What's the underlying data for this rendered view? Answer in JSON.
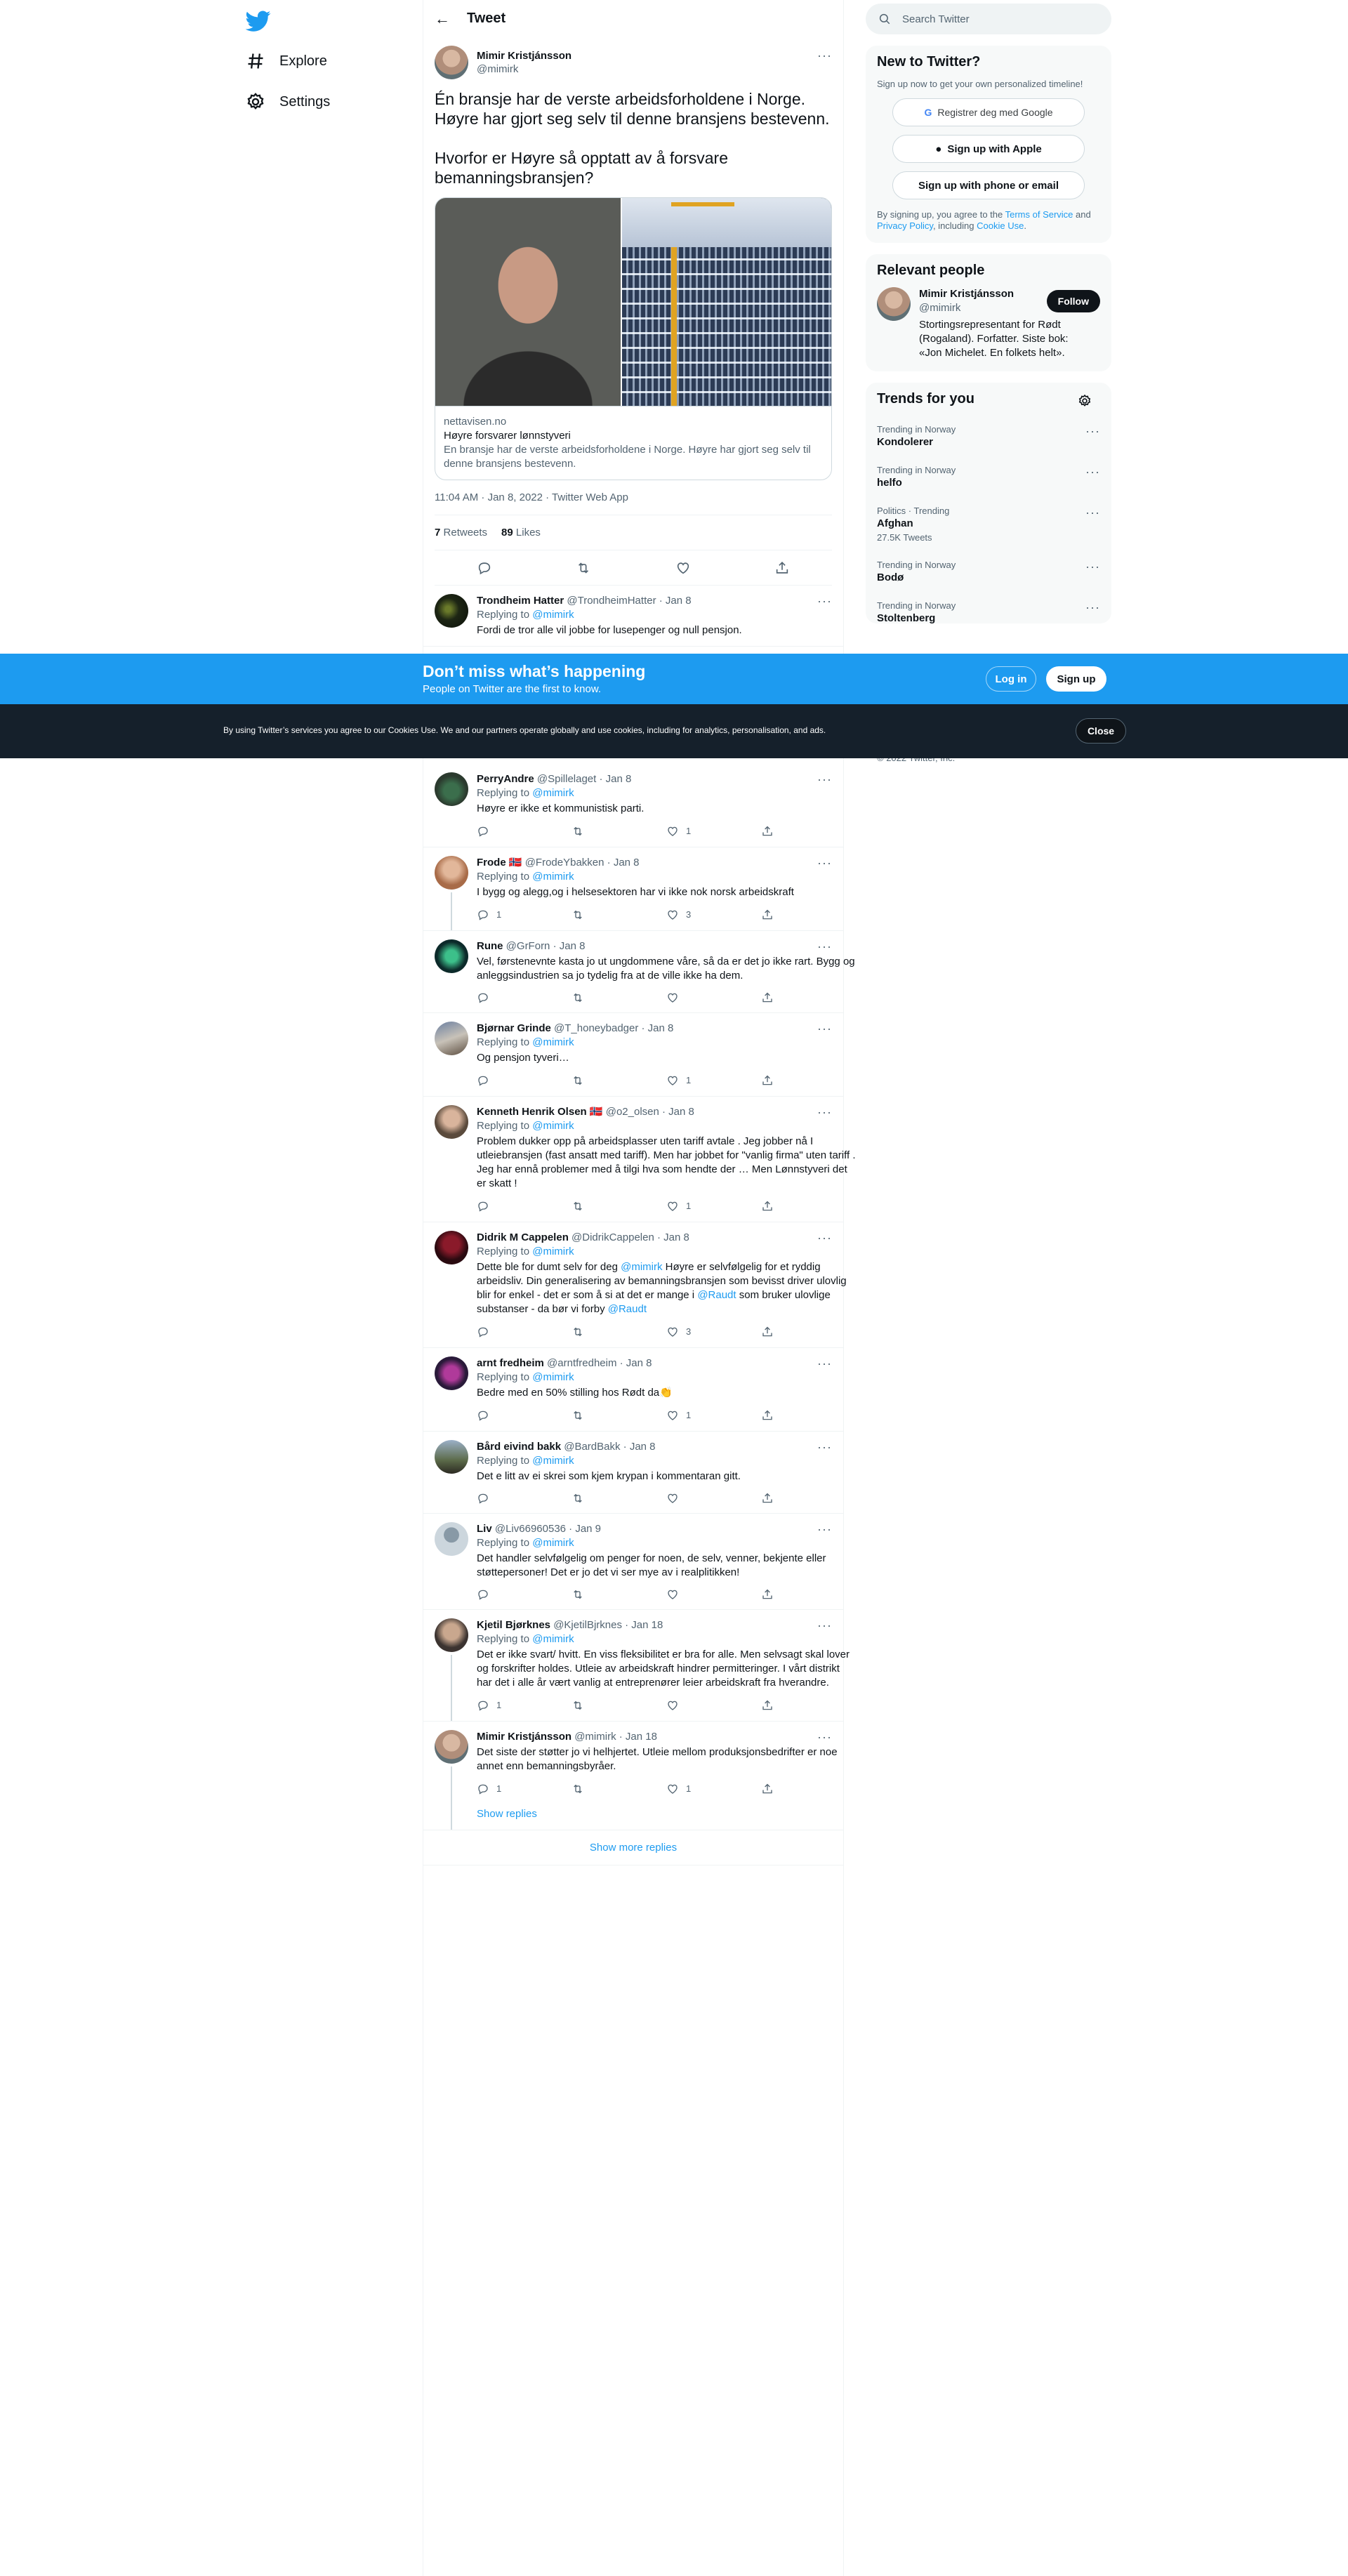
{
  "nav": {
    "explore": "Explore",
    "settings": "Settings"
  },
  "header": {
    "title": "Tweet"
  },
  "main_tweet": {
    "name": "Mimir Kristjánsson",
    "handle": "@mimirk",
    "text": "Én bransje har de verste arbeidsforholdene i Norge. Høyre har gjort seg selv til denne bransjens bestevenn.\n\nHvorfor er Høyre så opptatt av å forsvare bemanningsbransjen?",
    "card": {
      "domain": "nettavisen.no",
      "title": "Høyre forsvarer lønnstyveri",
      "description": "En bransje har de verste arbeidsforholdene i Norge. Høyre har gjort seg selv til denne bransjens bestevenn."
    },
    "meta": "11:04 AM · Jan 8, 2022 · Twitter Web App",
    "retweets_count": "7",
    "retweets_label": "Retweets",
    "likes_count": "89",
    "likes_label": "Likes"
  },
  "replies_top": [
    {
      "name": "Trondheim Hatter",
      "handle": "@TrondheimHatter",
      "date": "· Jan 8",
      "replying_label": "Replying to",
      "replying_to": "@mimirk",
      "text": "Fordi de tror alle vil jobbe for lusepenger og null pensjon."
    }
  ],
  "replies": [
    {
      "name": "PerryAndre",
      "handle": "@Spillelaget",
      "date": "· Jan 8",
      "replying_label": "Replying to",
      "replying_to": "@mimirk",
      "text": "Høyre er ikke et kommunistisk parti.",
      "reply_count": "",
      "rt_count": "",
      "like_count": "1"
    },
    {
      "name": "Frode 🇳🇴",
      "handle": "@FrodeYbakken",
      "date": "· Jan 8",
      "replying_label": "Replying to",
      "replying_to": "@mimirk",
      "text": "I bygg og alegg,og i helsesektoren har vi ikke nok norsk arbeidskraft",
      "reply_count": "1",
      "rt_count": "",
      "like_count": "3"
    },
    {
      "name": "Rune",
      "handle": "@GrForn",
      "date": "· Jan 8",
      "replying_label": "",
      "replying_to": "",
      "text": "Vel, førstenevnte kasta jo ut ungdommene våre, så da er det jo ikke rart. Bygg og anleggsindustrien sa jo tydelig fra at de ville ikke ha dem.",
      "reply_count": "",
      "rt_count": "",
      "like_count": ""
    },
    {
      "name": "Bjørnar Grinde",
      "handle": "@T_honeybadger",
      "date": "· Jan 8",
      "replying_label": "Replying to",
      "replying_to": "@mimirk",
      "text": "Og pensjon tyveri…",
      "reply_count": "",
      "rt_count": "",
      "like_count": "1"
    },
    {
      "name": "Kenneth Henrik Olsen 🇳🇴",
      "handle": "@o2_olsen",
      "date": "· Jan 8",
      "replying_label": "Replying to",
      "replying_to": "@mimirk",
      "text": "Problem dukker opp på arbeidsplasser uten tariff avtale . Jeg jobber nå I utleiebransjen (fast ansatt med tariff). Men har jobbet for \"vanlig firma\" uten tariff . Jeg har ennå problemer med å tilgi hva som hendte der … Men Lønnstyveri det er skatt !",
      "reply_count": "",
      "rt_count": "",
      "like_count": "1"
    },
    {
      "name": "Didrik M Cappelen",
      "handle": "@DidrikCappelen",
      "date": "· Jan 8",
      "replying_label": "Replying to",
      "replying_to": "@mimirk",
      "text_pre": "Dette ble for dumt selv for deg ",
      "text_mention1": "@mimirk",
      "text_mid": " Høyre er selvfølgelig for et ryddig arbeidsliv. Din generalisering av bemanningsbransjen som bevisst driver ulovlig blir for enkel - det er som å si at det er mange i ",
      "text_mention2": "@Raudt",
      "text_mid2": " som bruker ulovlige substanser - da bør vi forby ",
      "text_mention3": "@Raudt",
      "reply_count": "",
      "rt_count": "",
      "like_count": "3"
    },
    {
      "name": "arnt fredheim",
      "handle": "@arntfredheim",
      "date": "· Jan 8",
      "replying_label": "Replying to",
      "replying_to": "@mimirk",
      "text": "Bedre med en 50% stilling hos Rødt da👏",
      "reply_count": "",
      "rt_count": "",
      "like_count": "1"
    },
    {
      "name": "Bård eivind bakk",
      "handle": "@BardBakk",
      "date": "· Jan 8",
      "replying_label": "Replying to",
      "replying_to": "@mimirk",
      "text": "Det e litt av ei skrei som kjem krypan i kommentaran gitt.",
      "reply_count": "",
      "rt_count": "",
      "like_count": ""
    },
    {
      "name": "Liv",
      "handle": "@Liv66960536",
      "date": "· Jan 9",
      "replying_label": "Replying to",
      "replying_to": "@mimirk",
      "text": "Det handler selvfølgelig om penger for noen, de selv, venner, bekjente eller støttepersoner! Det er jo det vi ser mye av i realplitikken!",
      "reply_count": "",
      "rt_count": "",
      "like_count": ""
    },
    {
      "name": "Kjetil Bjørknes",
      "handle": "@KjetilBjrknes",
      "date": "· Jan 18",
      "replying_label": "Replying to",
      "replying_to": "@mimirk",
      "text": "Det er ikke svart/ hvitt. En viss fleksibilitet er bra for alle. Men selvsagt skal lover og forskrifter holdes. Utleie av arbeidskraft hindrer permitteringer. I vårt distrikt har det i alle år vært vanlig at entreprenører leier arbeidskraft fra hverandre.",
      "reply_count": "1",
      "rt_count": "",
      "like_count": ""
    },
    {
      "name": "Mimir Kristjánsson",
      "handle": "@mimirk",
      "date": "· Jan 18",
      "replying_label": "",
      "replying_to": "",
      "text": "Det siste der støtter jo vi helhjertet. Utleie mellom produksjonsbedrifter er noe annet enn bemanningsbyråer.",
      "reply_count": "1",
      "rt_count": "",
      "like_count": "1"
    }
  ],
  "show_replies": "Show replies",
  "show_more_replies": "Show more replies",
  "right": {
    "search_placeholder": "Search Twitter",
    "signup_title": "New to Twitter?",
    "signup_sub": "Sign up now to get your own personalized timeline!",
    "google_btn": "Registrer deg med Google",
    "apple_btn": "Sign up with Apple",
    "phone_btn": "Sign up with phone or email",
    "terms_pre": "By signing up, you agree to the ",
    "terms_link": "Terms of Service",
    "terms_and": " and ",
    "privacy_link": "Privacy Policy",
    "terms_including": ", including ",
    "cookie_link": "Cookie Use",
    "terms_end": ".",
    "relevant_title": "Relevant people",
    "rp_name": "Mimir Kristjánsson",
    "rp_handle": "@mimirk",
    "rp_bio": "Stortingsrepresentant for Rødt (Rogaland). Forfatter. Siste bok: «Jon Michelet. En folkets helt».",
    "follow_btn": "Follow",
    "trends_title": "Trends for you",
    "trends": [
      {
        "context": "Trending in Norway",
        "name": "Kondolerer",
        "tweets": ""
      },
      {
        "context": "Trending in Norway",
        "name": "helfo",
        "tweets": ""
      },
      {
        "context": "Politics · Trending",
        "name": "Afghan",
        "tweets": "27.5K Tweets"
      },
      {
        "context": "Trending in Norway",
        "name": "Bodø",
        "tweets": ""
      },
      {
        "context": "Trending in Norway",
        "name": "Stoltenberg",
        "tweets": ""
      }
    ],
    "copyright": "© 2022 Twitter, Inc."
  },
  "banner": {
    "title": "Don’t miss what’s happening",
    "subtitle": "People on Twitter are the first to know.",
    "login": "Log in",
    "signup": "Sign up"
  },
  "cookies": {
    "text": "By using Twitter’s services you agree to our Cookies Use. We and our partners operate globally and use cookies, including for analytics, personalisation, and ads.",
    "close": "Close"
  },
  "colors": {
    "accent": "#1d9bf0",
    "text": "#0f1419",
    "muted": "#536471",
    "cookie_bg": "#15202b"
  }
}
